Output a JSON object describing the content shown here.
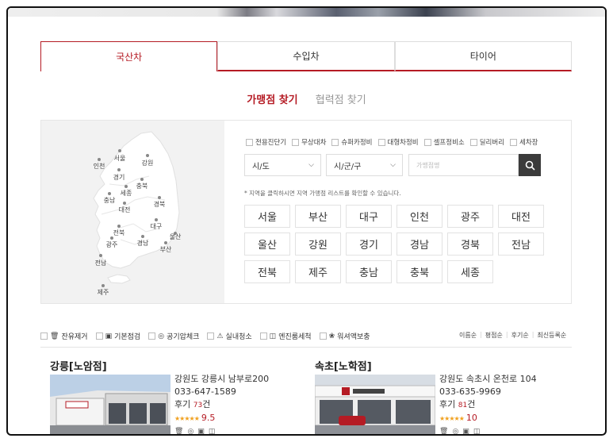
{
  "tabs": [
    {
      "label": "국산차",
      "active": true
    },
    {
      "label": "수입차",
      "active": false
    },
    {
      "label": "타이어",
      "active": false
    }
  ],
  "subtabs": {
    "active": "가맹점 찾기",
    "inactive": "협력점 찾기"
  },
  "filters": [
    "전용진단기",
    "무상대차",
    "슈퍼카정비",
    "대형차정비",
    "셀프정비소",
    "딜리버리",
    "세차장"
  ],
  "selects": {
    "sido": "시/도",
    "sigungu": "시/군/구"
  },
  "search": {
    "placeholder": "가맹점명"
  },
  "note": "* 지역을 클릭하시면 지역 가맹점 리스트를 확인할 수 있습니다.",
  "regions": [
    "서울",
    "부산",
    "대구",
    "인천",
    "광주",
    "대전",
    "울산",
    "강원",
    "경기",
    "경남",
    "경북",
    "전남",
    "전북",
    "제주",
    "충남",
    "충북",
    "세종"
  ],
  "map_labels": [
    "인천",
    "서울",
    "강원",
    "경기",
    "세종",
    "충북",
    "충남",
    "대전",
    "경북",
    "전북",
    "대구",
    "울산",
    "광주",
    "경남",
    "부산",
    "전남",
    "제주"
  ],
  "services": [
    {
      "icon": "trash-icon",
      "label": "잔유제거"
    },
    {
      "icon": "clipboard-icon",
      "label": "기본점검"
    },
    {
      "icon": "gauge-icon",
      "label": "공기압체크"
    },
    {
      "icon": "vacuum-icon",
      "label": "실내청소"
    },
    {
      "icon": "engine-icon",
      "label": "엔진룸세척"
    },
    {
      "icon": "washer-icon",
      "label": "워셔액보충"
    }
  ],
  "sorts": [
    "이름순",
    "평점순",
    "후기순",
    "최신등록순"
  ],
  "shops": [
    {
      "name": "강릉[노암점]",
      "address": "강원도 강릉시 남부로200",
      "phone": "033-647-1589",
      "review_prefix": "후기",
      "review_count": "73",
      "review_suffix": "건",
      "stars": "★★★★★",
      "score": "9.5"
    },
    {
      "name": "속초[노학점]",
      "address": "강원도 속초시 온천로 104",
      "phone": "033-635-9969",
      "review_prefix": "후기",
      "review_count": "81",
      "review_suffix": "건",
      "stars": "★★★★★",
      "score": "10"
    }
  ],
  "colors": {
    "accent": "#b51b24",
    "star": "#f0a01e",
    "search_button": "#3b3b3b"
  }
}
